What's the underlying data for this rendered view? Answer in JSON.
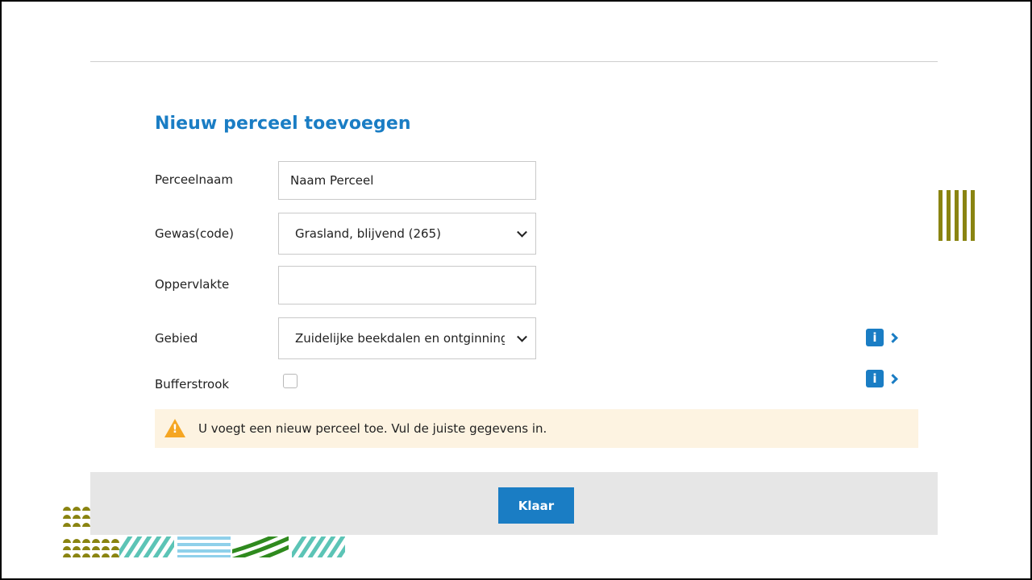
{
  "form": {
    "title": "Nieuw perceel toevoegen",
    "fields": {
      "perceelnaam": {
        "label": "Perceelnaam",
        "value": "Naam Perceel"
      },
      "gewas": {
        "label": "Gewas(code)",
        "value": "Grasland, blijvend (265)"
      },
      "oppervlakte": {
        "label": "Oppervlakte",
        "value": ""
      },
      "gebied": {
        "label": "Gebied",
        "value": "Zuidelijke beekdalen en ontginningen"
      },
      "bufferstrook": {
        "label": "Bufferstrook",
        "checked": false
      }
    },
    "info_icon_glyph": "i",
    "alert": {
      "icon": "warning-icon",
      "message": "U voegt een nieuw perceel toe. Vul de juiste gegevens in."
    },
    "submit_label": "Klaar"
  },
  "colors": {
    "accent": "#1a7dc4",
    "alert_background": "#fdf3e1",
    "warning": "#f5a623",
    "footer": "#e6e6e6",
    "decoration_olive": "#8a8411",
    "decoration_teal": "#5cc4b6",
    "decoration_lightblue": "#8fd0ea",
    "decoration_green": "#2f8a1e"
  }
}
